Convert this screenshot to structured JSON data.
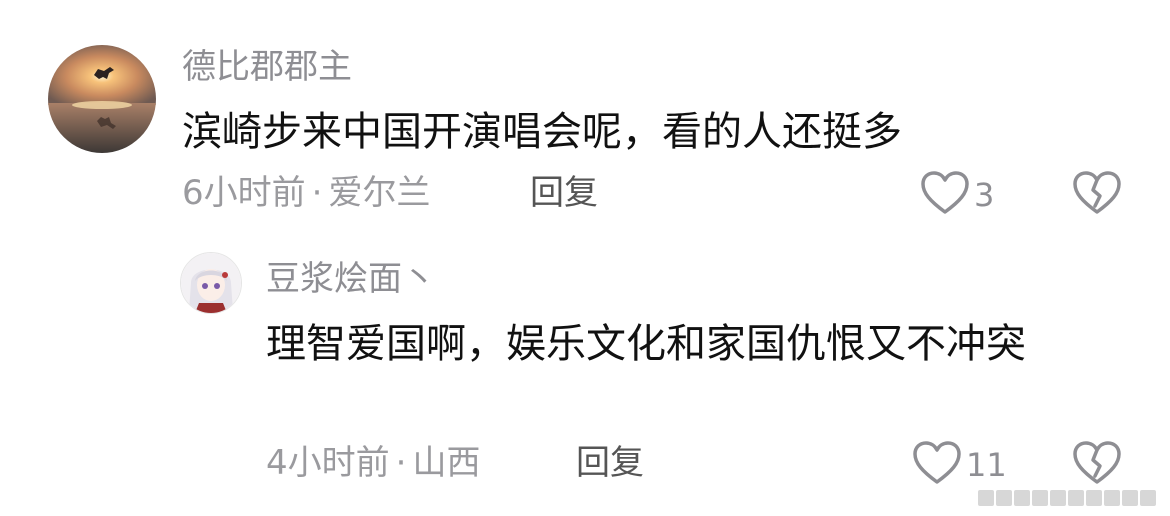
{
  "comments": [
    {
      "username": "德比郡郡主",
      "text": "滨崎步来中国开演唱会呢，看的人还挺多",
      "time": "6小时前",
      "separator": "·",
      "location": "爱尔兰",
      "reply_label": "回复",
      "like_count": "3",
      "avatar_icon": "sunset-silhouette-avatar"
    },
    {
      "username": "豆浆烩面丶",
      "text": "理智爱国啊，娱乐文化和家国仇恨又不冲突",
      "time": "4小时前",
      "separator": "·",
      "location": "山西",
      "reply_label": "回复",
      "like_count": "11",
      "avatar_icon": "anime-girl-avatar"
    }
  ],
  "icons": {
    "like": "heart-outline-icon",
    "dislike": "broken-heart-icon"
  },
  "colors": {
    "text_primary": "#111111",
    "text_secondary": "#8e8e93",
    "reply": "#555555"
  }
}
